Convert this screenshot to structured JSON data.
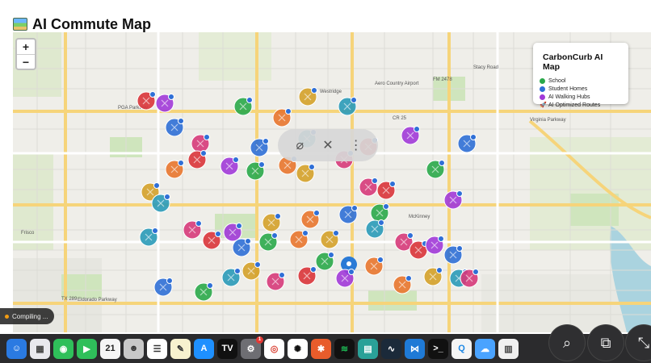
{
  "header": {
    "title": "AI Commute Map",
    "icon": "world-map-icon"
  },
  "map": {
    "zoom_in": "+",
    "zoom_out": "−",
    "roads": {
      "pga_parkway": "PGA Parkway",
      "virginia_parkway": "Virginia Parkway",
      "eldorado_parkway": "Eldorado Parkway",
      "stacy_road": "Stacy Road",
      "westridge": "Westridge",
      "mckinney": "McKinney",
      "airport": "Aero Country Airport",
      "cr": "CR 25",
      "fm2478": "FM 2478",
      "tx289": "TX 289",
      "frisco": "Frisco"
    },
    "colors": {
      "school": "#2aa84a",
      "student_homes": "#2f6fd6",
      "walking_hubs": "#a13ad8",
      "routes_orange": "#e8762d",
      "routes_red": "#d9343a",
      "routes_gold": "#d4a12a",
      "routes_teal": "#2a9ab8",
      "routes_pink": "#d63a7a"
    }
  },
  "legend": {
    "title": "CarbonCurb AI Map",
    "items": [
      {
        "label": "School",
        "color": "#2aa84a"
      },
      {
        "label": "Student Homes",
        "color": "#2f6fd6"
      },
      {
        "label": "AI Walking Hubs",
        "color": "#a13ad8"
      },
      {
        "label": "AI Optimized Routes",
        "icon": "rocket-icon"
      }
    ]
  },
  "overlay": {
    "items": [
      "pin-off-icon",
      "mute-icon",
      "more-icon"
    ]
  },
  "status": {
    "compiling": "Compiling ..."
  },
  "dock": {
    "calendar_day": "21",
    "notification_count": "1"
  },
  "fabs": [
    "zoom-icon",
    "open-external-icon",
    "collapse-icon"
  ]
}
